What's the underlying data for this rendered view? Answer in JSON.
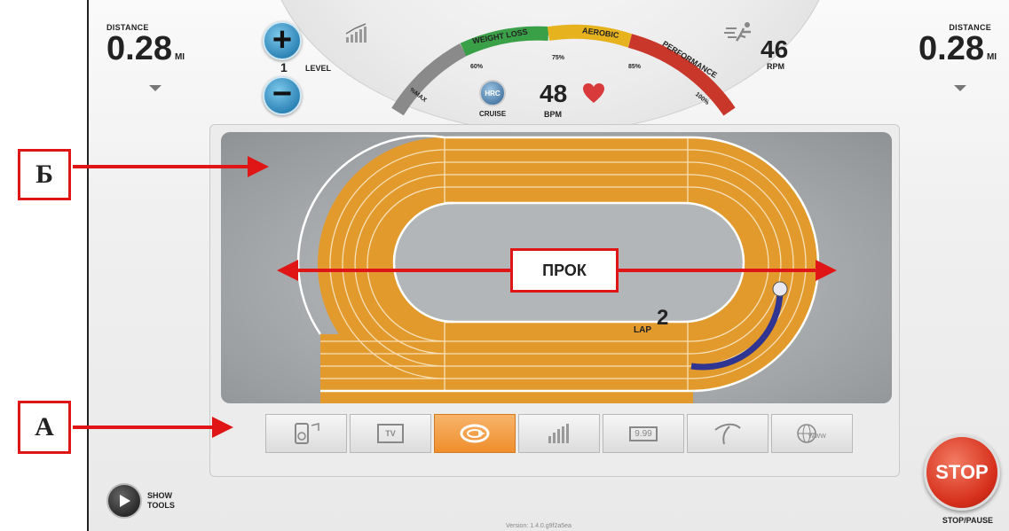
{
  "header": {
    "distance_label": "DISTANCE",
    "distance_value": "0.28",
    "distance_unit": "MI",
    "level_label": "LEVEL",
    "level_value": "1",
    "rpm_value": "46",
    "rpm_label": "RPM",
    "bpm_value": "48",
    "bpm_label": "BPM",
    "cruise_label": "CRUISE",
    "hrc_label": "HRC"
  },
  "hr_zones": {
    "labels": [
      "%MAX",
      "WEIGHT LOSS",
      "AEROBIC",
      "PERFORMANCE"
    ],
    "ticks": [
      "60%",
      "75%",
      "85%",
      "100%"
    ],
    "colors": [
      "#8a8a8a",
      "#3aa048",
      "#e6b21e",
      "#c9372a"
    ]
  },
  "track": {
    "lap_label": "LAP",
    "lap_value": "2",
    "progress_fraction": 0.12
  },
  "toolbar": {
    "tools": [
      "music-player",
      "tv",
      "track-laps",
      "workout-stats",
      "display-value",
      "course-map",
      "web-browser"
    ],
    "tv_label": "TV",
    "value_label": "9.99",
    "www_label": "WWW",
    "active_index": 2
  },
  "controls": {
    "show_tools_label_1": "SHOW",
    "show_tools_label_2": "TOOLS",
    "stop_label": "STOP",
    "stop_pause_label": "STOP/PAUSE"
  },
  "footer": {
    "version": "Version: 1.4.0.g9f2a5ea"
  },
  "annotations": {
    "label_b": "Б",
    "label_a": "А",
    "label_prok": "ПРОК",
    "color": "#e01515"
  }
}
